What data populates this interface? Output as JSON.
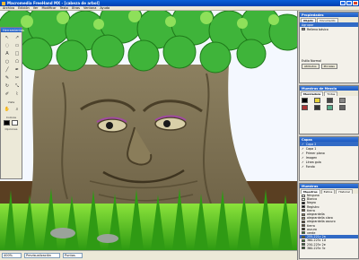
{
  "window": {
    "title": "Macromedia FreeHand MX - [cabeza de arbol]"
  },
  "menu": [
    "Archivo",
    "Edición",
    "Ver",
    "Modificar",
    "Texto",
    "Xtras",
    "Ventana",
    "Ayuda"
  ],
  "tools_panel": {
    "title": "Herramientas",
    "sections": [
      "Vista",
      "Colores",
      "Opciones"
    ]
  },
  "status": {
    "zoom": "400%",
    "view_mode": "Previsualización",
    "units": "Puntos"
  },
  "properties_panel": {
    "title": "Propiedades",
    "tabs": [
      "Objeto",
      "Documento"
    ],
    "object_type": "Agrupar",
    "fill_label": "Relleno básico",
    "rows": [
      "Estilo Normal"
    ],
    "buttons": [
      "Atributos",
      "Pinceles"
    ]
  },
  "swatches_panel": {
    "title": "Muestras de Mezcla",
    "tabs": [
      "Mezcladora",
      "Tintas"
    ]
  },
  "layers_panel": {
    "title": "Capas",
    "layers": [
      "Capa 2",
      "Capa 1",
      "Primer plano",
      "Imagen",
      "Línea guía",
      "Fondo"
    ],
    "selected": 0
  },
  "colors_panel": {
    "title": "Muestras",
    "tabs": [
      "Muestras",
      "Estilos",
      "Historial"
    ],
    "items": [
      "Ninguno",
      "Blanco",
      "Negro",
      "Registro",
      "tierra",
      "alegrardella",
      "alegrardella claro",
      "alegrardella oscuro",
      "tierra",
      "oscuro",
      "verde",
      "255-221c 2a",
      "360-225c 1d",
      "250-225c 2e",
      "360-225c 3c"
    ],
    "item_colors": [
      "#ffffff",
      "#ffffff",
      "#000000",
      "#000000",
      "#6b5a3a",
      "#8a7a55",
      "#a89870",
      "#5a4a30",
      "#5c4a2a",
      "#2a2010",
      "#2e7d2e",
      "#4a6a1a",
      "#3a7a2a",
      "#3e6e3a",
      "#2a5a1a"
    ],
    "selected": 11
  },
  "colors": {
    "accent": "#316ac5",
    "title_bar": "#0a5fd8",
    "panel_bg": "#d4d0c8"
  }
}
